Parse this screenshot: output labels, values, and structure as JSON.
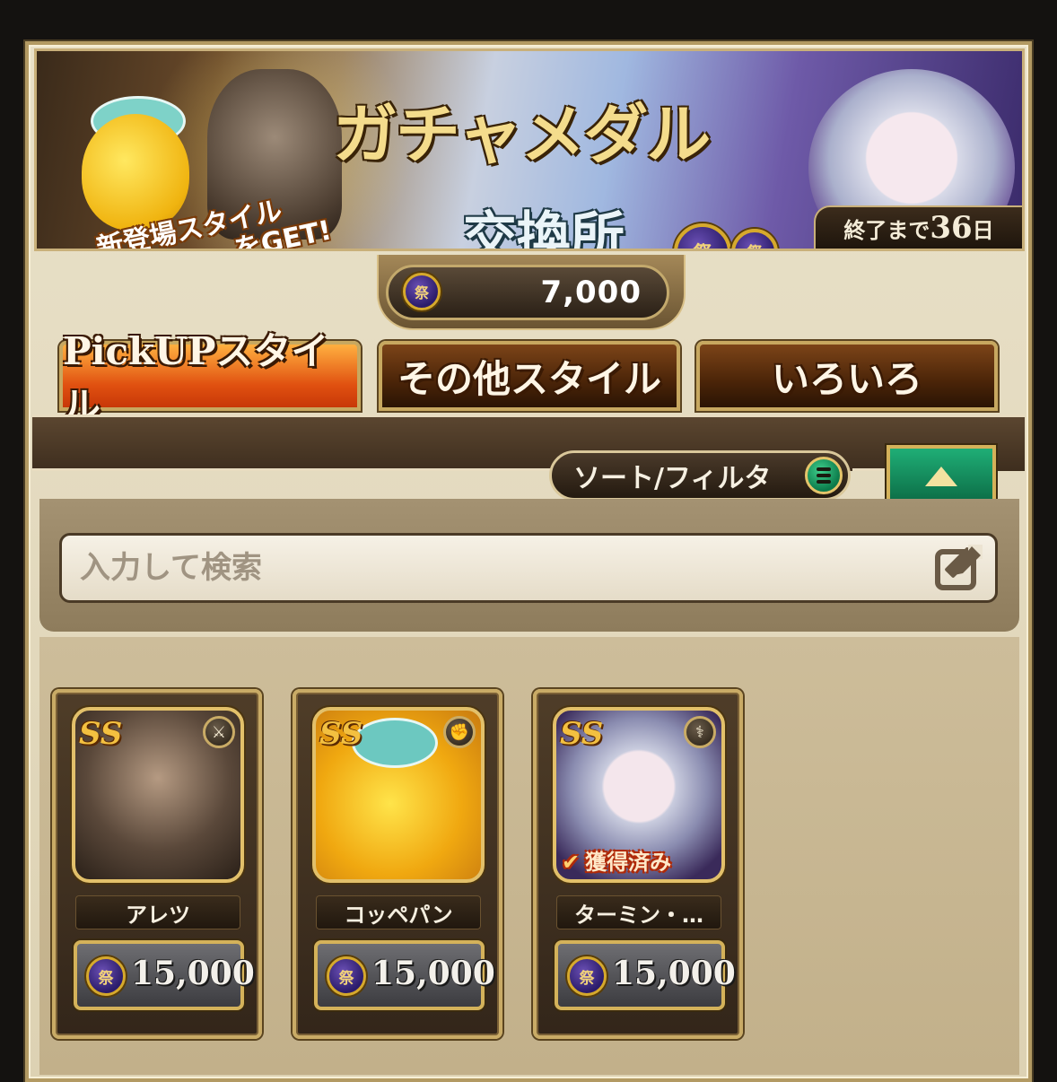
{
  "banner": {
    "title": "ガチャメダル",
    "subtitle": "交換所",
    "tagline_1": "新登場スタイル",
    "tagline_2": "をGET!",
    "medal_glyph": "祭",
    "days_prefix": "終了まで",
    "days_value": "36",
    "days_suffix": "日"
  },
  "balance": {
    "icon": "festival-medal-icon",
    "value": "7,000"
  },
  "tabs": [
    {
      "label": "PickUPスタイル",
      "active": true
    },
    {
      "label": "その他スタイル",
      "active": false
    },
    {
      "label": "いろいろ",
      "active": false
    }
  ],
  "toolbar": {
    "sort_label": "ソート/フィルタ",
    "sort_icon": "list-icon",
    "collapse_icon": "triangle-up-icon"
  },
  "search": {
    "placeholder": "入力して検索",
    "icon": "edit-icon"
  },
  "cards": [
    {
      "rank": "SS",
      "weapon_icon": "sword-icon",
      "weapon_glyph": "⚔",
      "name": "アレツ",
      "price": "15,000",
      "owned": false
    },
    {
      "rank": "SS",
      "weapon_icon": "fist-icon",
      "weapon_glyph": "✊",
      "name": "コッペパン",
      "price": "15,000",
      "owned": false
    },
    {
      "rank": "SS",
      "weapon_icon": "staff-icon",
      "weapon_glyph": "⚕",
      "name": "ターミン・…",
      "price": "15,000",
      "owned": true,
      "owned_label": "獲得済み"
    }
  ],
  "colors": {
    "tab_active": "#e05010",
    "tab_inactive": "#4a2408",
    "gold_border": "#c9ab66",
    "sort_icon": "#0b7a4a",
    "medal": "#2b1c6a"
  }
}
